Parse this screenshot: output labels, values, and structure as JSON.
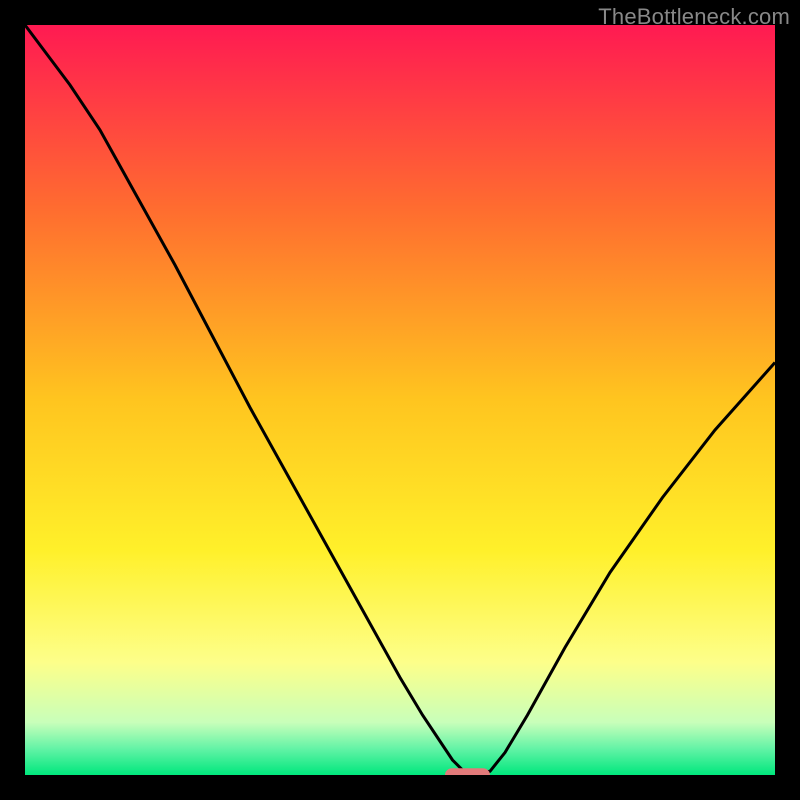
{
  "watermark": "TheBottleneck.com",
  "chart_data": {
    "type": "line",
    "title": "",
    "xlabel": "",
    "ylabel": "",
    "xlim": [
      0,
      100
    ],
    "ylim": [
      0,
      100
    ],
    "grid": false,
    "legend": false,
    "background_gradient": {
      "stops": [
        {
          "offset": 0.0,
          "color": "#ff1a52"
        },
        {
          "offset": 0.25,
          "color": "#ff6e2f"
        },
        {
          "offset": 0.5,
          "color": "#ffc51f"
        },
        {
          "offset": 0.7,
          "color": "#fff02a"
        },
        {
          "offset": 0.85,
          "color": "#fdff8a"
        },
        {
          "offset": 0.93,
          "color": "#c8ffba"
        },
        {
          "offset": 0.965,
          "color": "#63f3a6"
        },
        {
          "offset": 1.0,
          "color": "#00e77d"
        }
      ]
    },
    "series": [
      {
        "name": "bottleneck-curve",
        "color": "#000000",
        "x": [
          0.0,
          3.0,
          6.0,
          10.0,
          15.0,
          20.0,
          25.0,
          30.0,
          35.0,
          40.0,
          45.0,
          50.0,
          53.0,
          55.0,
          57.0,
          58.5,
          60.0,
          62.0,
          64.0,
          67.0,
          72.0,
          78.0,
          85.0,
          92.0,
          100.0
        ],
        "y": [
          100.0,
          96.0,
          92.0,
          86.0,
          77.0,
          68.0,
          58.5,
          49.0,
          40.0,
          31.0,
          22.0,
          13.0,
          8.0,
          5.0,
          2.0,
          0.5,
          0.0,
          0.5,
          3.0,
          8.0,
          17.0,
          27.0,
          37.0,
          46.0,
          55.0
        ]
      }
    ],
    "markers": [
      {
        "name": "target-marker",
        "shape": "rounded-bar",
        "color": "#e27a7a",
        "x": 59.0,
        "y": 0.0,
        "width_pct": 6.0,
        "height_pct": 1.8
      }
    ]
  }
}
